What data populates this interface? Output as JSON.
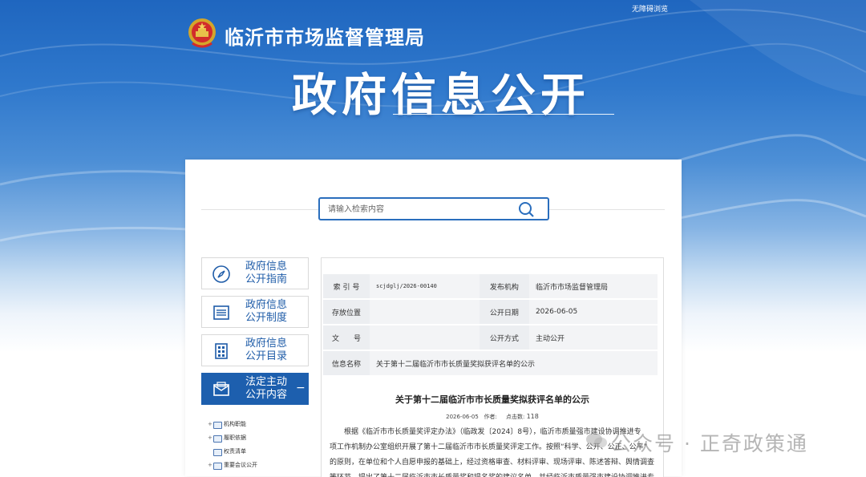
{
  "header": {
    "top_link": "无障碍浏览",
    "site_name": "临沂市市场监督管理局",
    "banner_title": "政府信息公开"
  },
  "search": {
    "placeholder": "请输入检索内容"
  },
  "sidebar": {
    "items": [
      {
        "label_line1": "政府信息",
        "label_line2": "公开指南",
        "icon": "compass-icon"
      },
      {
        "label_line1": "政府信息",
        "label_line2": "公开制度",
        "icon": "list-icon"
      },
      {
        "label_line1": "政府信息",
        "label_line2": "公开目录",
        "icon": "catalog-icon"
      },
      {
        "label_line1": "法定主动",
        "label_line2": "公开内容",
        "icon": "envelope-icon",
        "toggle": "−"
      }
    ],
    "tree": [
      {
        "toggle": "+",
        "label": "机构职能"
      },
      {
        "toggle": "+",
        "label": "履职依据"
      },
      {
        "toggle": "",
        "label": "权责清单"
      },
      {
        "toggle": "+",
        "label": "重要会议公开"
      }
    ]
  },
  "meta": {
    "index_no_label": "索 引 号",
    "index_no": "scjdglj/2026-00140",
    "publisher_label": "发布机构",
    "publisher": "临沂市市场监督管理局",
    "storage_label": "存放位置",
    "storage": "",
    "date_label": "公开日期",
    "date": "2026-06-05",
    "docno_label": "文　　号",
    "docno": "",
    "method_label": "公开方式",
    "method": "主动公开",
    "name_label": "信息名称",
    "name": "关于第十二届临沂市市长质量奖拟获评名单的公示"
  },
  "article": {
    "title": "关于第十二届临沂市市长质量奖拟获评名单的公示",
    "date": "2026-06-05",
    "author_label": "作者:",
    "clicks_label": "点击数:",
    "clicks": "118",
    "body_lines": [
      "根据《临沂市市长质量奖评定办法》（临政发〔2024〕8号），临沂市质量强市建设协调推进专",
      "项工作机制办公室组织开展了第十二届临沂市市长质量奖评定工作。按照“科学、公开、公正、公平”",
      "的原则，在单位和个人自愿申报的基础上，经过资格审查、材料评审、现场评审、陈述答辩、舆情调查",
      "等环节，提出了第十二届临沂市市长质量奖和提名奖的建议名单，并经临沂市质量强市建设协调推进专"
    ]
  },
  "watermark": {
    "text": "公众号 · 正奇政策通"
  },
  "colors": {
    "brand_blue": "#1d5fae",
    "link_blue": "#1f5ca8",
    "search_border": "#2a6ebd"
  }
}
